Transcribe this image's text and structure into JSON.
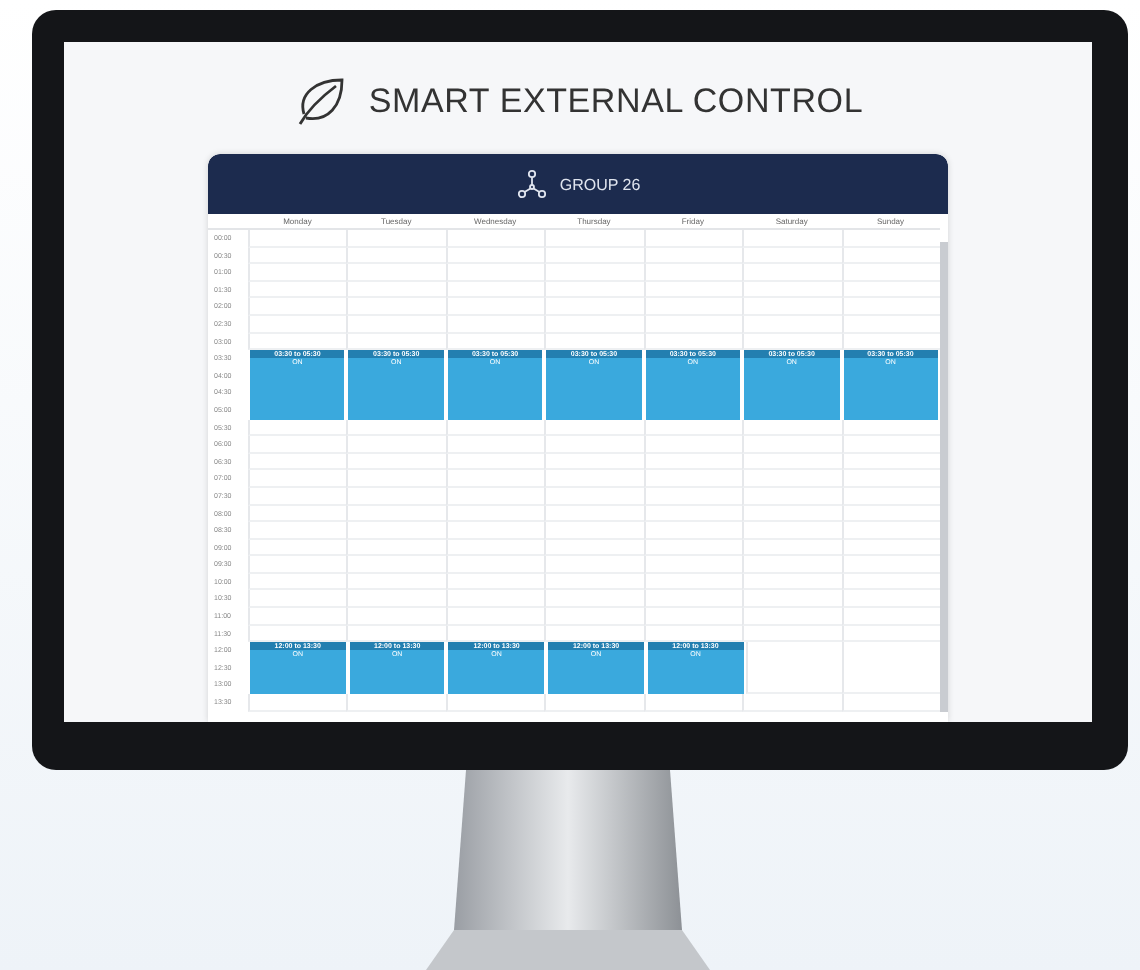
{
  "title": "SMART EXTERNAL CONTROL",
  "calendar": {
    "group": "GROUP 26",
    "days": [
      "Monday",
      "Tuesday",
      "Wednesday",
      "Thursday",
      "Friday",
      "Saturday",
      "Sunday"
    ],
    "rows": [
      {
        "kind": "slot",
        "time": "00:00"
      },
      {
        "kind": "slot",
        "time": "00:30"
      },
      {
        "kind": "slot",
        "time": "01:00"
      },
      {
        "kind": "slot",
        "time": "01:30"
      },
      {
        "kind": "slot",
        "time": "02:00"
      },
      {
        "kind": "slot",
        "time": "02:30"
      },
      {
        "kind": "slot",
        "time": "03:00"
      },
      {
        "kind": "band",
        "times": [
          "03:30",
          "04:00",
          "04:30",
          "05:00"
        ],
        "events": [
          {
            "label": "03:30 to 05:30",
            "status": "ON"
          },
          {
            "label": "03:30 to 05:30",
            "status": "ON"
          },
          {
            "label": "03:30 to 05:30",
            "status": "ON"
          },
          {
            "label": "03:30 to 05:30",
            "status": "ON"
          },
          {
            "label": "03:30 to 05:30",
            "status": "ON"
          },
          {
            "label": "03:30 to 05:30",
            "status": "ON"
          },
          {
            "label": "03:30 to 05:30",
            "status": "ON"
          }
        ]
      },
      {
        "kind": "slot",
        "time": "05:30"
      },
      {
        "kind": "slot",
        "time": "06:00"
      },
      {
        "kind": "slot",
        "time": "06:30"
      },
      {
        "kind": "slot",
        "time": "07:00"
      },
      {
        "kind": "slot",
        "time": "07:30"
      },
      {
        "kind": "slot",
        "time": "08:00"
      },
      {
        "kind": "slot",
        "time": "08:30"
      },
      {
        "kind": "slot",
        "time": "09:00"
      },
      {
        "kind": "slot",
        "time": "09:30"
      },
      {
        "kind": "slot",
        "time": "10:00"
      },
      {
        "kind": "slot",
        "time": "10:30"
      },
      {
        "kind": "slot",
        "time": "11:00"
      },
      {
        "kind": "slot",
        "time": "11:30"
      },
      {
        "kind": "band",
        "times": [
          "12:00",
          "12:30",
          "13:00"
        ],
        "events": [
          {
            "label": "12:00 to 13:30",
            "status": "ON"
          },
          {
            "label": "12:00 to 13:30",
            "status": "ON"
          },
          {
            "label": "12:00 to 13:30",
            "status": "ON"
          },
          {
            "label": "12:00 to 13:30",
            "status": "ON"
          },
          {
            "label": "12:00 to 13:30",
            "status": "ON"
          }
        ]
      },
      {
        "kind": "slot",
        "time": "13:30"
      }
    ]
  }
}
